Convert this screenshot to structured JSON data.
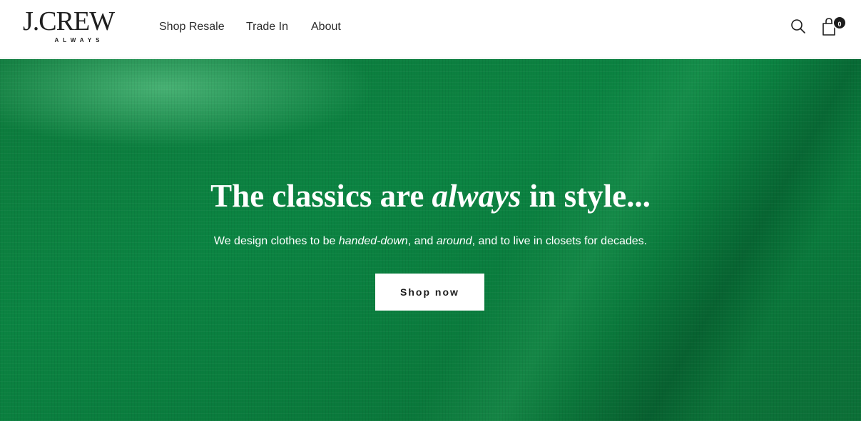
{
  "brand": {
    "logo_main": "J.CREW",
    "logo_sub": "ALWAYS"
  },
  "nav": {
    "items": [
      {
        "label": "Shop Resale"
      },
      {
        "label": "Trade In"
      },
      {
        "label": "About"
      }
    ]
  },
  "header_actions": {
    "search_icon": "search-icon",
    "cart_icon": "shopping-bag-icon",
    "cart_count": "0"
  },
  "hero": {
    "title_part1": "The classics are ",
    "title_emphasis": "always",
    "title_part2": " in style...",
    "subtitle_part1": "We design clothes to be ",
    "subtitle_emphasis1": "handed-down",
    "subtitle_part2": ", and ",
    "subtitle_emphasis2": "around",
    "subtitle_part3": ", and to live in closets for decades.",
    "cta_label": "Shop now",
    "background_color": "#0b8442"
  }
}
